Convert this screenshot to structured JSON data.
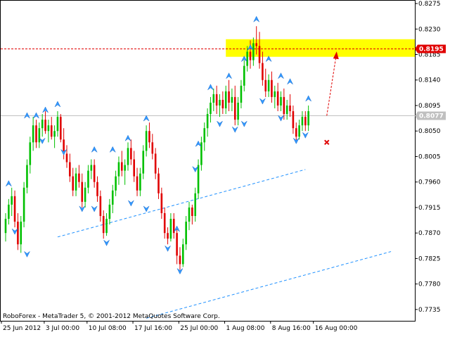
{
  "chart_data": {
    "type": "candlestick",
    "footer": "RoboForex - MetaTrader 5, © 2001-2012 MetaQuotes Software Corp.",
    "ylim": [
      0.7715,
      0.828
    ],
    "y_ticks": [
      "0.8275",
      "0.8230",
      "0.8185",
      "0.8140",
      "0.8095",
      "0.8050",
      "0.8005",
      "0.7960",
      "0.7915",
      "0.7870",
      "0.7825",
      "0.7780",
      "0.7735"
    ],
    "x_ticks": [
      "25 Jun 2012",
      "3 Jul 00:00",
      "10 Jul 08:00",
      "17 Jul 16:00",
      "25 Jul 00:00",
      "1 Aug 08:00",
      "8 Aug 16:00",
      "16 Aug 00:00"
    ],
    "resistance_price": "0.8195",
    "current_price": "0.8077",
    "colors": {
      "bull": "#00c000",
      "bear": "#e00000",
      "fractal": "#3399ff",
      "channel": "#1e90ff",
      "resistance": "#e00000",
      "zone": "#ffff00",
      "current": "#c0c0c0",
      "target_arrow": "#e00000"
    },
    "target_zone": {
      "y_range": [
        0.8181,
        0.8212
      ]
    },
    "target_price": 0.8188,
    "stop_price": 0.803,
    "candles": [
      [
        0.787,
        0.7905,
        0.7855,
        0.7895
      ],
      [
        0.7895,
        0.793,
        0.7885,
        0.792
      ],
      [
        0.792,
        0.795,
        0.79,
        0.7935
      ],
      [
        0.7935,
        0.7945,
        0.788,
        0.789
      ],
      [
        0.789,
        0.7905,
        0.784,
        0.785
      ],
      [
        0.785,
        0.79,
        0.7835,
        0.789
      ],
      [
        0.789,
        0.796,
        0.788,
        0.795
      ],
      [
        0.795,
        0.8,
        0.794,
        0.799
      ],
      [
        0.799,
        0.804,
        0.7975,
        0.803
      ],
      [
        0.803,
        0.8075,
        0.8015,
        0.806
      ],
      [
        0.806,
        0.807,
        0.802,
        0.803
      ],
      [
        0.803,
        0.8065,
        0.802,
        0.8055
      ],
      [
        0.8055,
        0.808,
        0.804,
        0.807
      ],
      [
        0.807,
        0.8085,
        0.8045,
        0.805
      ],
      [
        0.805,
        0.807,
        0.803,
        0.806
      ],
      [
        0.806,
        0.8075,
        0.8035,
        0.804
      ],
      [
        0.804,
        0.806,
        0.802,
        0.805
      ],
      [
        0.805,
        0.8085,
        0.804,
        0.8075
      ],
      [
        0.8075,
        0.808,
        0.803,
        0.8035
      ],
      [
        0.8035,
        0.8055,
        0.8,
        0.801
      ],
      [
        0.801,
        0.8025,
        0.7985,
        0.7995
      ],
      [
        0.7995,
        0.801,
        0.796,
        0.797
      ],
      [
        0.797,
        0.7985,
        0.7935,
        0.7945
      ],
      [
        0.7945,
        0.7985,
        0.7935,
        0.7975
      ],
      [
        0.7975,
        0.799,
        0.795,
        0.796
      ],
      [
        0.796,
        0.7975,
        0.7915,
        0.7925
      ],
      [
        0.7925,
        0.796,
        0.7915,
        0.795
      ],
      [
        0.795,
        0.799,
        0.794,
        0.798
      ],
      [
        0.798,
        0.8,
        0.7965,
        0.799
      ],
      [
        0.799,
        0.8,
        0.795,
        0.796
      ],
      [
        0.796,
        0.797,
        0.7925,
        0.7935
      ],
      [
        0.7935,
        0.7945,
        0.789,
        0.79
      ],
      [
        0.79,
        0.791,
        0.786,
        0.787
      ],
      [
        0.787,
        0.7905,
        0.7865,
        0.7895
      ],
      [
        0.7895,
        0.793,
        0.7885,
        0.792
      ],
      [
        0.792,
        0.7955,
        0.7905,
        0.7945
      ],
      [
        0.7945,
        0.798,
        0.7935,
        0.797
      ],
      [
        0.797,
        0.8005,
        0.7955,
        0.7995
      ],
      [
        0.7995,
        0.8015,
        0.797,
        0.798
      ],
      [
        0.798,
        0.8,
        0.7955,
        0.799
      ],
      [
        0.799,
        0.803,
        0.798,
        0.802
      ],
      [
        0.802,
        0.8035,
        0.799,
        0.8
      ],
      [
        0.8,
        0.8015,
        0.796,
        0.797
      ],
      [
        0.797,
        0.7985,
        0.7935,
        0.7945
      ],
      [
        0.7945,
        0.7985,
        0.7935,
        0.7975
      ],
      [
        0.7975,
        0.8025,
        0.7965,
        0.8015
      ],
      [
        0.8015,
        0.806,
        0.8005,
        0.805
      ],
      [
        0.805,
        0.8065,
        0.802,
        0.803
      ],
      [
        0.803,
        0.8045,
        0.8,
        0.801
      ],
      [
        0.801,
        0.802,
        0.7965,
        0.7975
      ],
      [
        0.7975,
        0.7985,
        0.793,
        0.794
      ],
      [
        0.794,
        0.795,
        0.7895,
        0.7905
      ],
      [
        0.7905,
        0.7915,
        0.786,
        0.787
      ],
      [
        0.787,
        0.788,
        0.785,
        0.786
      ],
      [
        0.786,
        0.7905,
        0.7855,
        0.7895
      ],
      [
        0.7895,
        0.7905,
        0.786,
        0.787
      ],
      [
        0.787,
        0.788,
        0.7815,
        0.783
      ],
      [
        0.783,
        0.7845,
        0.7805,
        0.7815
      ],
      [
        0.7815,
        0.786,
        0.781,
        0.785
      ],
      [
        0.785,
        0.79,
        0.784,
        0.789
      ],
      [
        0.789,
        0.7925,
        0.7875,
        0.7915
      ],
      [
        0.7915,
        0.792,
        0.7885,
        0.79
      ],
      [
        0.79,
        0.795,
        0.789,
        0.794
      ],
      [
        0.794,
        0.8,
        0.793,
        0.799
      ],
      [
        0.799,
        0.804,
        0.798,
        0.803
      ],
      [
        0.803,
        0.8065,
        0.8015,
        0.8055
      ],
      [
        0.8055,
        0.809,
        0.804,
        0.808
      ],
      [
        0.808,
        0.811,
        0.8065,
        0.81
      ],
      [
        0.81,
        0.8125,
        0.8085,
        0.8115
      ],
      [
        0.8115,
        0.813,
        0.808,
        0.8095
      ],
      [
        0.8095,
        0.8115,
        0.8075,
        0.8105
      ],
      [
        0.8105,
        0.812,
        0.808,
        0.809
      ],
      [
        0.809,
        0.813,
        0.808,
        0.812
      ],
      [
        0.812,
        0.814,
        0.8085,
        0.81
      ],
      [
        0.81,
        0.8125,
        0.8085,
        0.811
      ],
      [
        0.811,
        0.813,
        0.806,
        0.807
      ],
      [
        0.807,
        0.811,
        0.806,
        0.81
      ],
      [
        0.81,
        0.814,
        0.809,
        0.813
      ],
      [
        0.813,
        0.8175,
        0.812,
        0.8165
      ],
      [
        0.8165,
        0.82,
        0.8155,
        0.819
      ],
      [
        0.819,
        0.821,
        0.816,
        0.8175
      ],
      [
        0.8175,
        0.8215,
        0.8165,
        0.8205
      ],
      [
        0.8205,
        0.8235,
        0.8185,
        0.82
      ],
      [
        0.82,
        0.8225,
        0.816,
        0.817
      ],
      [
        0.817,
        0.819,
        0.813,
        0.814
      ],
      [
        0.814,
        0.816,
        0.811,
        0.812
      ],
      [
        0.812,
        0.815,
        0.811,
        0.814
      ],
      [
        0.814,
        0.8155,
        0.81,
        0.811
      ],
      [
        0.811,
        0.813,
        0.809,
        0.812
      ],
      [
        0.812,
        0.8135,
        0.8085,
        0.8095
      ],
      [
        0.8095,
        0.812,
        0.8085,
        0.811
      ],
      [
        0.811,
        0.8125,
        0.807,
        0.808
      ],
      [
        0.808,
        0.8105,
        0.807,
        0.8095
      ],
      [
        0.8095,
        0.8115,
        0.8075,
        0.8085
      ],
      [
        0.8085,
        0.8095,
        0.8045,
        0.8055
      ],
      [
        0.8055,
        0.8065,
        0.803,
        0.804
      ],
      [
        0.804,
        0.807,
        0.8035,
        0.806
      ],
      [
        0.806,
        0.8085,
        0.805,
        0.8075
      ],
      [
        0.8075,
        0.8085,
        0.805,
        0.806
      ],
      [
        0.806,
        0.8095,
        0.805,
        0.8085
      ]
    ],
    "fractals_up": [
      [
        1,
        0.796
      ],
      [
        7,
        0.808
      ],
      [
        10,
        0.808
      ],
      [
        13,
        0.809
      ],
      [
        17,
        0.81
      ],
      [
        29,
        0.802
      ],
      [
        35,
        0.802
      ],
      [
        40,
        0.804
      ],
      [
        46,
        0.8075
      ],
      [
        56,
        0.788
      ],
      [
        63,
        0.803
      ],
      [
        67,
        0.813
      ],
      [
        73,
        0.815
      ],
      [
        78,
        0.818
      ],
      [
        80,
        0.82
      ],
      [
        82,
        0.825
      ],
      [
        86,
        0.818
      ],
      [
        90,
        0.815
      ],
      [
        93,
        0.814
      ],
      [
        99,
        0.811
      ]
    ],
    "fractals_down": [
      [
        3,
        0.787
      ],
      [
        7,
        0.783
      ],
      [
        12,
        0.803
      ],
      [
        19,
        0.801
      ],
      [
        25,
        0.791
      ],
      [
        29,
        0.791
      ],
      [
        33,
        0.785
      ],
      [
        41,
        0.792
      ],
      [
        46,
        0.791
      ],
      [
        53,
        0.784
      ],
      [
        57,
        0.78
      ],
      [
        62,
        0.798
      ],
      [
        70,
        0.806
      ],
      [
        75,
        0.805
      ],
      [
        78,
        0.806
      ],
      [
        84,
        0.81
      ],
      [
        90,
        0.807
      ],
      [
        95,
        0.803
      ],
      [
        98,
        0.804
      ]
    ]
  }
}
